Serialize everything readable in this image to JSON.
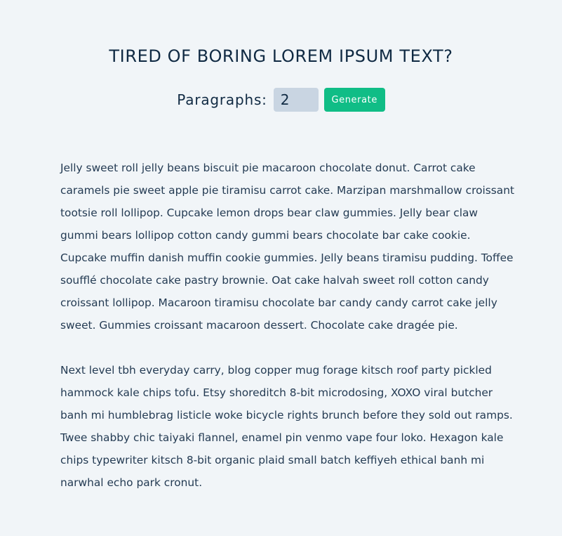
{
  "header": {
    "title": "TIRED OF BORING LOREM IPSUM TEXT?"
  },
  "form": {
    "label": "Paragraphs:",
    "amount_value": "2",
    "generate_label": "Generate"
  },
  "paragraphs": [
    "Jelly sweet roll jelly beans biscuit pie macaroon chocolate donut. Carrot cake caramels pie sweet apple pie tiramisu carrot cake. Marzipan marshmallow croissant tootsie roll lollipop. Cupcake lemon drops bear claw gummies. Jelly bear claw gummi bears lollipop cotton candy gummi bears chocolate bar cake cookie. Cupcake muffin danish muffin cookie gummies. Jelly beans tiramisu pudding. Toffee soufflé chocolate cake pastry brownie. Oat cake halvah sweet roll cotton candy croissant lollipop. Macaroon tiramisu chocolate bar candy candy carrot cake jelly sweet. Gummies croissant macaroon dessert. Chocolate cake dragée pie.",
    "Next level tbh everyday carry, blog copper mug forage kitsch roof party pickled hammock kale chips tofu. Etsy shoreditch 8-bit microdosing, XOXO viral butcher banh mi humblebrag listicle woke bicycle rights brunch before they sold out ramps. Twee shabby chic taiyaki flannel, enamel pin venmo vape four loko. Hexagon kale chips typewriter kitsch 8-bit organic plaid small batch keffiyeh ethical banh mi narwhal echo park cronut."
  ],
  "colors": {
    "background": "#f1f5f8",
    "input_background": "#c9d5e2",
    "button": "#10bd86",
    "heading": "#102a43",
    "body_text": "#243b53"
  }
}
